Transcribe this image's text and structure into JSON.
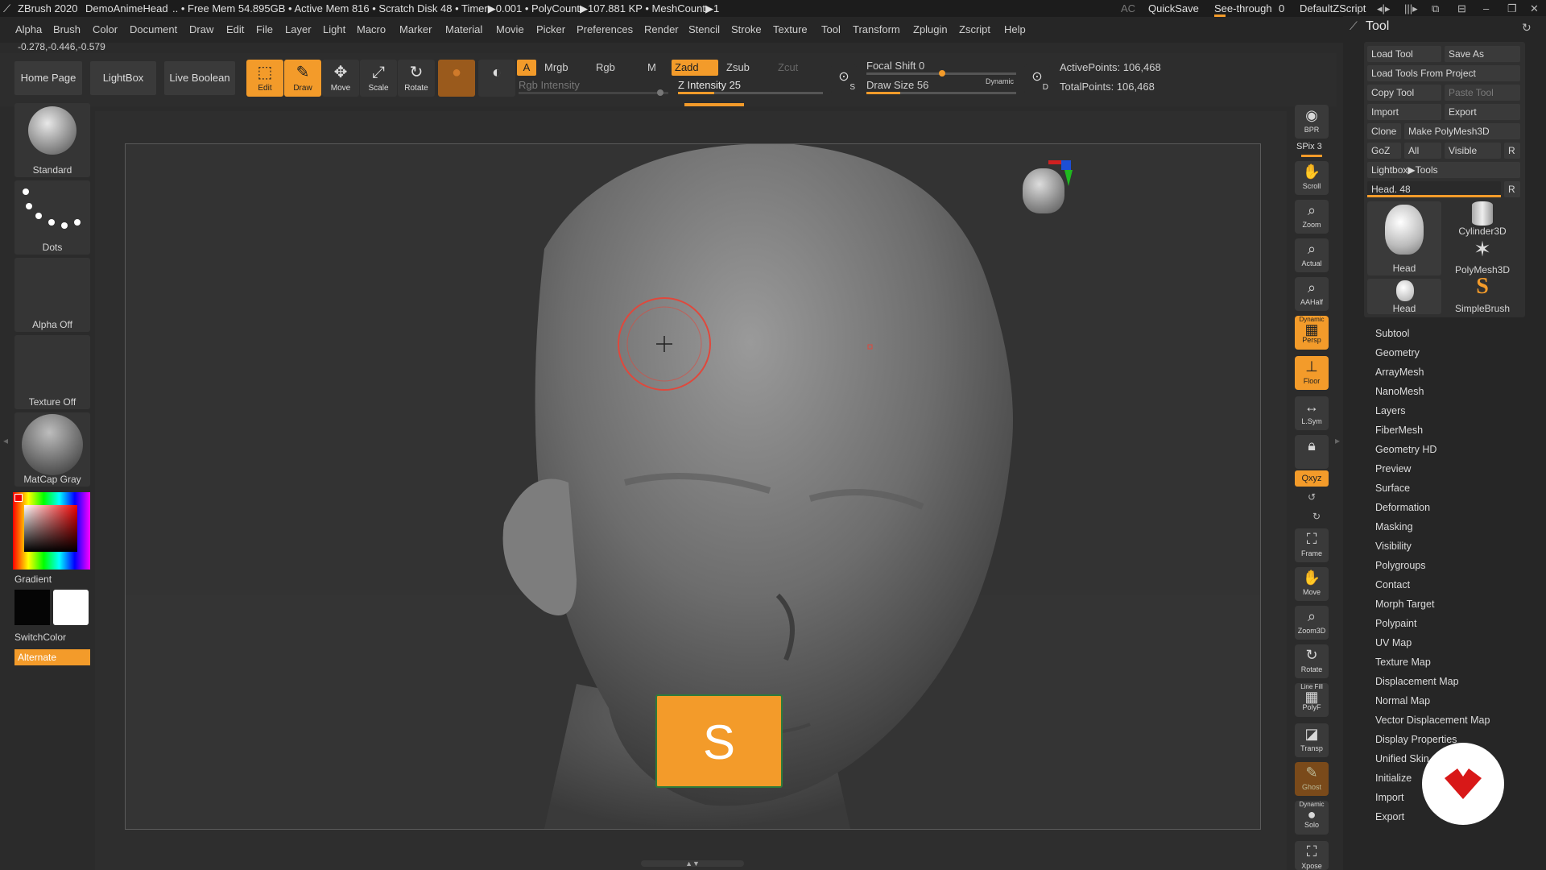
{
  "titlebar": {
    "app": "ZBrush 2020",
    "doc": "DemoAnimeHead",
    "stats": ".. • Free Mem 54.895GB • Active Mem 816 • Scratch Disk 48 • Timer▶0.001 • PolyCount▶107.881 KP • MeshCount▶1",
    "ac": "AC",
    "quicksave": "QuickSave",
    "seethrough": "See-through",
    "seethrough_value": "0",
    "script": "DefaultZScript"
  },
  "menu": [
    "Alpha",
    "Brush",
    "Color",
    "Document",
    "Draw",
    "Edit",
    "File",
    "Layer",
    "Light",
    "Macro",
    "Marker",
    "Material",
    "Movie",
    "Picker",
    "Preferences",
    "Render",
    "Stencil",
    "Stroke",
    "Texture",
    "Tool",
    "Transform",
    "Zplugin",
    "Zscript",
    "Help"
  ],
  "coords": "-0.278,-0.446,-0.579",
  "toolbar": {
    "home": "Home Page",
    "lightbox": "LightBox",
    "liveboolean": "Live Boolean",
    "edit": "Edit",
    "draw": "Draw",
    "move": "Move",
    "scale": "Scale",
    "rotate": "Rotate",
    "a": "A",
    "mrgb": "Mrgb",
    "rgb": "Rgb",
    "m": "M",
    "zadd": "Zadd",
    "zsub": "Zsub",
    "zcut": "Zcut",
    "rgb_intensity": "Rgb Intensity",
    "z_intensity": "Z Intensity 25",
    "z_intensity_value": 25,
    "focal_shift": "Focal Shift 0",
    "focal_shift_value": 0,
    "draw_size": "Draw Size 56",
    "draw_size_value": 56,
    "dynamic": "Dynamic",
    "active_points": "ActivePoints: 106,468",
    "total_points": "TotalPoints: 106,468",
    "s_mark": "S",
    "d_mark": "D"
  },
  "left": {
    "brush": "Standard",
    "stroke": "Dots",
    "alpha": "Alpha Off",
    "texture": "Texture Off",
    "material": "MatCap Gray",
    "gradient": "Gradient",
    "switchcolor": "SwitchColor",
    "alternate": "Alternate"
  },
  "shelf": {
    "bpr": "BPR",
    "spix": "SPix 3",
    "scroll": "Scroll",
    "zoom": "Zoom",
    "actual": "Actual",
    "aahalf": "AAHalf",
    "dynamic": "Dynamic",
    "persp": "Persp",
    "floor": "Floor",
    "lsym": "L.Sym",
    "xyz": "Qxyz",
    "frame": "Frame",
    "move": "Move",
    "zoom3d": "Zoom3D",
    "rotate": "Rotate",
    "linefill": "Line Fill",
    "polyf": "PolyF",
    "transp": "Transp",
    "ghost": "Ghost",
    "dynamic2": "Dynamic",
    "solo": "Solo",
    "xpose": "Xpose"
  },
  "tool": {
    "title": "Tool",
    "load_tool": "Load Tool",
    "save_as": "Save As",
    "load_from_project": "Load Tools From Project",
    "copy_tool": "Copy Tool",
    "paste_tool": "Paste Tool",
    "import": "Import",
    "export": "Export",
    "clone": "Clone",
    "make_polymesh": "Make PolyMesh3D",
    "goz": "GoZ",
    "all": "All",
    "visible": "Visible",
    "r": "R",
    "lightbox_tools": "Lightbox▶Tools",
    "head_slider": "Head. 48",
    "head_value": 48,
    "thumbs": [
      "Head",
      "Cylinder3D",
      "PolyMesh3D",
      "Head",
      "SimpleBrush"
    ],
    "items": [
      "Subtool",
      "Geometry",
      "ArrayMesh",
      "NanoMesh",
      "Layers",
      "FiberMesh",
      "Geometry HD",
      "Preview",
      "Surface",
      "Deformation",
      "Masking",
      "Visibility",
      "Polygroups",
      "Contact",
      "Morph Target",
      "Polypaint",
      "UV Map",
      "Texture Map",
      "Displacement Map",
      "Normal Map",
      "Vector Displacement Map",
      "Display Properties",
      "Unified Skin",
      "Initialize",
      "Import",
      "Export"
    ]
  },
  "overlay": {
    "key": "S"
  },
  "colors": {
    "accent": "#f39b2a",
    "bg": "#2b2b2b",
    "brush_ring": "#e0483c"
  }
}
